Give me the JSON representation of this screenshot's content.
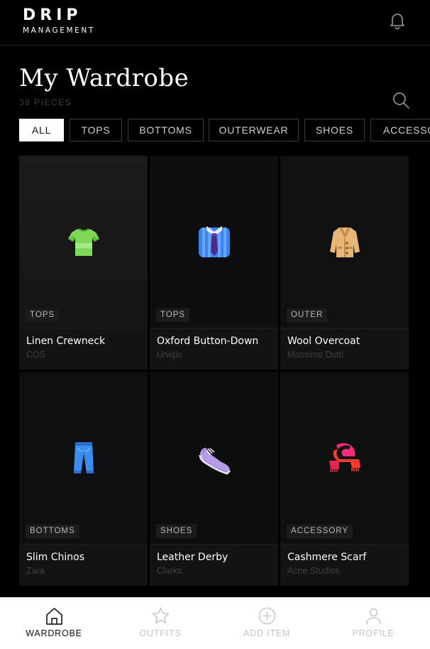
{
  "header": {
    "brand_name": "DRIP",
    "brand_sub": "MANAGEMENT",
    "icon": "bell-icon"
  },
  "page": {
    "title": "My Wardrobe",
    "count": "38 PIECES",
    "search_icon": "search-icon"
  },
  "filters": [
    "ALL",
    "TOPS",
    "BOTTOMS",
    "OUTERWEAR",
    "SHOES",
    "ACCESSORIES"
  ],
  "active_filter": "ALL",
  "items": [
    {
      "tag": "TOPS",
      "name": "Linen Crewneck",
      "brand": "COS",
      "icon": "t-shirt-icon"
    },
    {
      "tag": "TOPS",
      "name": "Oxford Button-Down",
      "brand": "Uniqlo",
      "icon": "shirt-tie-icon"
    },
    {
      "tag": "OUTER",
      "name": "Wool Overcoat",
      "brand": "Massimo Dutti",
      "icon": "coat-icon"
    },
    {
      "tag": "BOTTOMS",
      "name": "Slim Chinos",
      "brand": "Zara",
      "icon": "jeans-icon"
    },
    {
      "tag": "SHOES",
      "name": "Leather Derby",
      "brand": "Clarks",
      "icon": "sneaker-icon"
    },
    {
      "tag": "ACCESSORY",
      "name": "Cashmere Scarf",
      "brand": "Acne Studios",
      "icon": "scarf-icon"
    }
  ],
  "tabbar": [
    {
      "label": "WARDROBE",
      "icon": "home-icon",
      "active": true
    },
    {
      "label": "OUTFITS",
      "icon": "star-icon",
      "active": false
    },
    {
      "label": "ADD ITEM",
      "icon": "add-circle-icon",
      "active": false
    },
    {
      "label": "PROFILE",
      "icon": "user-icon",
      "active": false
    }
  ],
  "colors": {
    "background": "#000000",
    "card": "#0d0d0d",
    "active_chip": "#ffffff",
    "tabbar": "#ffffff"
  }
}
